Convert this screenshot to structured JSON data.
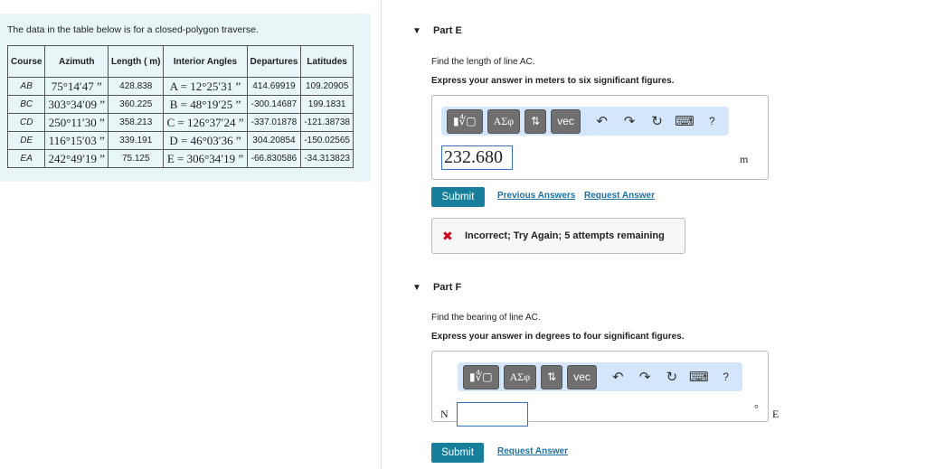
{
  "problem": {
    "intro": "The data in the table below is for a closed-polygon traverse.",
    "headers": [
      "Course",
      "Azimuth",
      "Length ( m)",
      "Interior Angles",
      "Departures",
      "Latitudes"
    ],
    "rows": [
      [
        "AB",
        "75°14′47 ”",
        "428.838",
        "A = 12°25′31 ”",
        "414.69919",
        "109.20905"
      ],
      [
        "BC",
        "303°34′09 ”",
        "360.225",
        "B = 48°19′25 ”",
        "-300.14687",
        "199.1831"
      ],
      [
        "CD",
        "250°11′30 ”",
        "358.213",
        "C = 126°37′24 ”",
        "-337.01878",
        "-121.38738"
      ],
      [
        "DE",
        "116°15′03 ”",
        "339.191",
        "D = 46°03′36 ”",
        "304.20854",
        "-150.02565"
      ],
      [
        "EA",
        "242°49′19 ”",
        "75.125",
        "E = 306°34′19 ”",
        "-66.830586",
        "-34.313823"
      ]
    ]
  },
  "toolbar": {
    "templates": "▮∜▢",
    "greek": "ΑΣφ",
    "arrows": "⇅",
    "vec": "vec",
    "undo": "↶",
    "redo": "↷",
    "reset": "↻",
    "keyboard": "⌨",
    "help": "?"
  },
  "partE": {
    "title": "Part E",
    "question": "Find the length of line AC.",
    "instruction": "Express your answer in meters to six significant figures.",
    "answer": "232.680",
    "unit": "m",
    "submit": "Submit",
    "previous": "Previous Answers",
    "request": "Request Answer",
    "feedback_icon": "✖",
    "feedback": "Incorrect; Try Again; 5 attempts remaining"
  },
  "partF": {
    "title": "Part F",
    "question": "Find the bearing of line AC.",
    "instruction": "Express your answer in degrees to four significant figures.",
    "prefix": "N",
    "answer": "",
    "degree": "°",
    "suffix": "E",
    "submit": "Submit",
    "request": "Request Answer"
  },
  "arrow": "▼"
}
